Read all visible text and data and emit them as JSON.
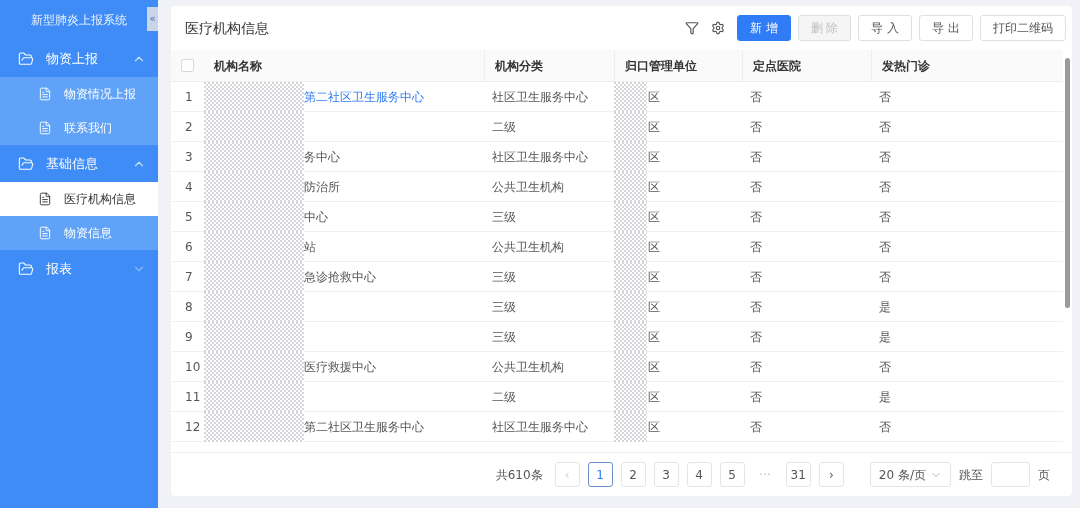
{
  "sidebar": {
    "title": "新型肺炎上报系统",
    "collapse": "«",
    "groups": [
      {
        "label": "物资上报",
        "expanded": true,
        "children": [
          {
            "label": "物资情况上报",
            "selected": false
          },
          {
            "label": "联系我们",
            "selected": false
          }
        ]
      },
      {
        "label": "基础信息",
        "expanded": true,
        "children": [
          {
            "label": "医疗机构信息",
            "selected": true
          },
          {
            "label": "物资信息",
            "selected": false
          }
        ]
      },
      {
        "label": "报表",
        "expanded": false
      }
    ]
  },
  "page": {
    "title": "医疗机构信息",
    "buttons": [
      {
        "label": "新 增",
        "kind": "primary"
      },
      {
        "label": "删 除",
        "kind": "disabled"
      },
      {
        "label": "导 入",
        "kind": "default"
      },
      {
        "label": "导 出",
        "kind": "default"
      },
      {
        "label": "打印二维码",
        "kind": "default"
      }
    ]
  },
  "table": {
    "columns": [
      "机构名称",
      "机构分类",
      "归口管理单位",
      "定点医院",
      "发热门诊"
    ],
    "select_all": {
      "checked": false
    },
    "rows": [
      {
        "index": "1",
        "name": "第二社区卫生服务中心",
        "link": true,
        "category": "社区卫生服务中心",
        "unit": "区",
        "designated": "否",
        "fever": "否"
      },
      {
        "index": "2",
        "category": "二级",
        "unit": "区",
        "designated": "否",
        "fever": "否"
      },
      {
        "index": "3",
        "name": "务中心",
        "link": false,
        "category": "社区卫生服务中心",
        "unit": "区",
        "designated": "否",
        "fever": "否"
      },
      {
        "index": "4",
        "name": "防治所",
        "link": false,
        "category": "公共卫生机构",
        "unit": "区",
        "designated": "否",
        "fever": "否"
      },
      {
        "index": "5",
        "name": "中心",
        "link": false,
        "category": "三级",
        "unit": "区",
        "designated": "否",
        "fever": "否"
      },
      {
        "index": "6",
        "name": "站",
        "link": false,
        "category": "公共卫生机构",
        "unit": "区",
        "designated": "否",
        "fever": "否"
      },
      {
        "index": "7",
        "name": "急诊抢救中心",
        "link": false,
        "category": "三级",
        "unit": "区",
        "designated": "否",
        "fever": "否"
      },
      {
        "index": "8",
        "category": "三级",
        "unit": "区",
        "designated": "否",
        "fever": "是"
      },
      {
        "index": "9",
        "category": "三级",
        "unit": "区",
        "designated": "否",
        "fever": "是"
      },
      {
        "index": "10",
        "name": "医疗救援中心",
        "link": false,
        "category": "公共卫生机构",
        "unit": "区",
        "designated": "否",
        "fever": "否"
      },
      {
        "index": "11",
        "category": "二级",
        "unit": "区",
        "designated": "否",
        "fever": "是"
      },
      {
        "index": "12",
        "name": "第二社区卫生服务中心",
        "link": false,
        "category": "社区卫生服务中心",
        "unit": "区",
        "designated": "否",
        "fever": "否"
      }
    ]
  },
  "pagination": {
    "total": "共610条",
    "prev": {
      "label": "‹",
      "disabled": true
    },
    "next": {
      "label": "›",
      "disabled": false
    },
    "pages": [
      {
        "label": "1",
        "selected": true
      },
      {
        "label": "2",
        "selected": false
      },
      {
        "label": "3",
        "selected": false
      },
      {
        "label": "4",
        "selected": false
      },
      {
        "label": "5",
        "selected": false
      },
      {
        "label": "···",
        "kind": "ellipsis",
        "selected": false
      },
      {
        "label": "31",
        "selected": false
      }
    ],
    "page_size": "20 条/页",
    "jump_label": "跳至",
    "jump_suffix": "页"
  }
}
